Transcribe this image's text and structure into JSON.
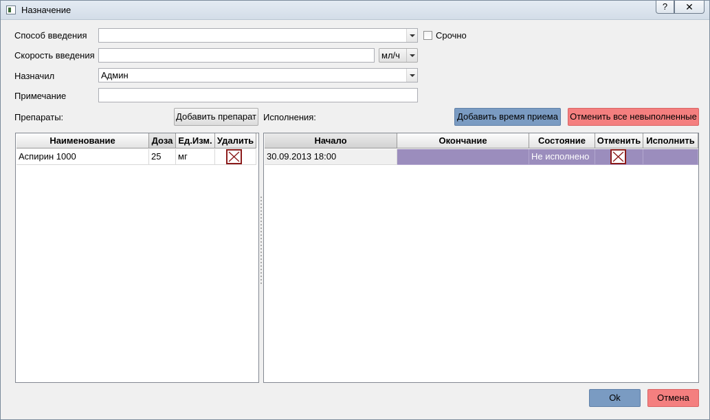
{
  "window": {
    "title": "Назначение",
    "help_label": "?",
    "close_label": "✕"
  },
  "form": {
    "route_label": "Способ введения",
    "route_value": "",
    "urgent_label": "Срочно",
    "speed_label": "Скорость введения",
    "speed_value": "",
    "speed_unit": "мл/ч",
    "prescriber_label": "Назначил",
    "prescriber_value": "Админ",
    "note_label": "Примечание",
    "note_value": ""
  },
  "drugs": {
    "section_label": "Препараты:",
    "add_button": "Добавить препарат",
    "columns": [
      "Наименование",
      "Доза",
      "Ед.Изм.",
      "Удалить"
    ],
    "rows": [
      {
        "name": "Аспирин 1000",
        "dose": "25",
        "unit": "мг"
      }
    ]
  },
  "executions": {
    "section_label": "Исполнения:",
    "add_time_button": "Добавить время приема",
    "cancel_all_button": "Отменить все невыполненные",
    "columns": [
      "Начало",
      "Окончание",
      "Состояние",
      "Отменить",
      "Исполнить"
    ],
    "rows": [
      {
        "start": "30.09.2013 18:00",
        "end": "",
        "state": "Не исполнено"
      }
    ]
  },
  "footer": {
    "ok_label": "Ok",
    "cancel_label": "Отмена"
  },
  "colors": {
    "accent_blue": "#7a9bc2",
    "accent_red": "#f47f7f",
    "selection": "#9b8dbd",
    "delete_icon": "#8b1a1a"
  }
}
